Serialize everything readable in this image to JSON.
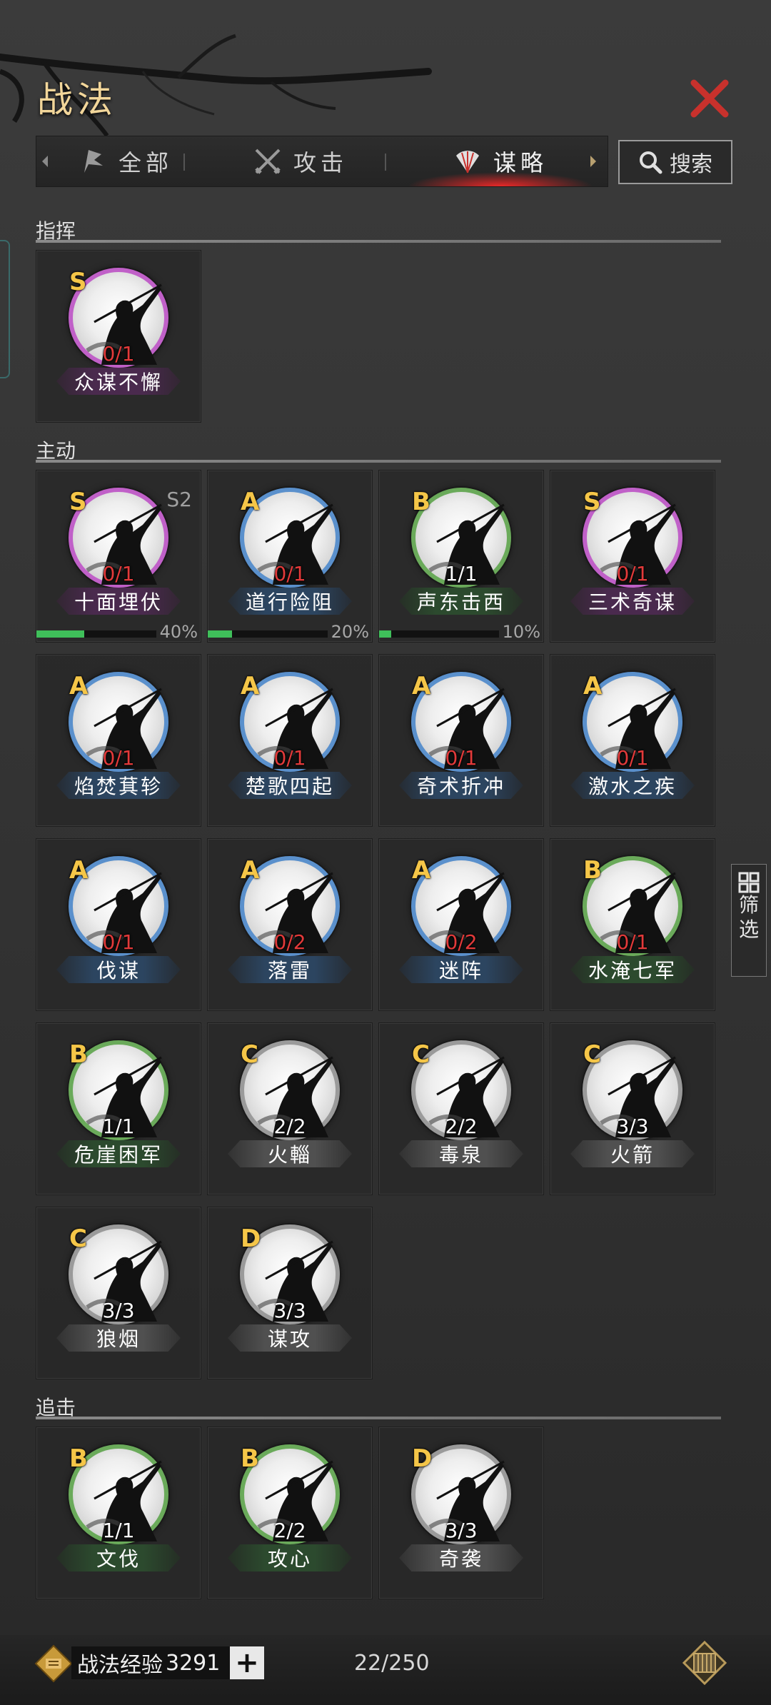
{
  "header": {
    "title": "战法",
    "close_icon": "close-x-icon",
    "accent": "#c8312c"
  },
  "tabs": [
    {
      "label": "全部",
      "icon": "flag-icon",
      "active": false
    },
    {
      "label": "攻击",
      "icon": "crossed-swords-icon",
      "active": false
    },
    {
      "label": "谋略",
      "icon": "fan-icon",
      "active": true
    }
  ],
  "search": {
    "label": "搜索",
    "icon": "search-icon"
  },
  "filter": {
    "label_1": "筛",
    "label_2": "选",
    "icon": "grid-icon"
  },
  "sections": {
    "command": {
      "title": "指挥",
      "cards": [
        {
          "grade": "S",
          "count": "0/1",
          "count_red": true,
          "name": "众谋不懈",
          "tier": "purple"
        }
      ]
    },
    "active": {
      "title": "主动",
      "cards": [
        {
          "grade": "S",
          "season": "S2",
          "count": "0/1",
          "count_red": true,
          "name": "十面埋伏",
          "tier": "purple",
          "progress": 40,
          "progress_label": "40%"
        },
        {
          "grade": "A",
          "count": "0/1",
          "count_red": true,
          "name": "道行险阻",
          "tier": "blue",
          "progress": 20,
          "progress_label": "20%"
        },
        {
          "grade": "B",
          "count": "1/1",
          "count_red": false,
          "name": "声东击西",
          "tier": "green",
          "progress": 10,
          "progress_label": "10%"
        },
        {
          "grade": "S",
          "count": "0/1",
          "count_red": true,
          "name": "三术奇谋",
          "tier": "purple"
        },
        {
          "grade": "A",
          "count": "0/1",
          "count_red": true,
          "name": "焰焚萁轸",
          "tier": "blue"
        },
        {
          "grade": "A",
          "count": "0/1",
          "count_red": true,
          "name": "楚歌四起",
          "tier": "blue"
        },
        {
          "grade": "A",
          "count": "0/1",
          "count_red": true,
          "name": "奇术折冲",
          "tier": "blue"
        },
        {
          "grade": "A",
          "count": "0/1",
          "count_red": true,
          "name": "激水之疾",
          "tier": "blue"
        },
        {
          "grade": "A",
          "count": "0/1",
          "count_red": true,
          "name": "伐谋",
          "tier": "blue"
        },
        {
          "grade": "A",
          "count": "0/2",
          "count_red": true,
          "name": "落雷",
          "tier": "blue"
        },
        {
          "grade": "A",
          "count": "0/2",
          "count_red": true,
          "name": "迷阵",
          "tier": "blue"
        },
        {
          "grade": "B",
          "count": "0/1",
          "count_red": true,
          "name": "水淹七军",
          "tier": "green"
        },
        {
          "grade": "B",
          "count": "1/1",
          "count_red": false,
          "name": "危崖困军",
          "tier": "green"
        },
        {
          "grade": "C",
          "count": "2/2",
          "count_red": false,
          "name": "火輜",
          "tier": "gray"
        },
        {
          "grade": "C",
          "count": "2/2",
          "count_red": false,
          "name": "毒泉",
          "tier": "gray"
        },
        {
          "grade": "C",
          "count": "3/3",
          "count_red": false,
          "name": "火箭",
          "tier": "gray"
        },
        {
          "grade": "C",
          "count": "3/3",
          "count_red": false,
          "name": "狼烟",
          "tier": "gray"
        },
        {
          "grade": "D",
          "count": "3/3",
          "count_red": false,
          "name": "谋攻",
          "tier": "gray"
        }
      ]
    },
    "pursuit": {
      "title": "追击",
      "cards": [
        {
          "grade": "B",
          "count": "1/1",
          "count_red": false,
          "name": "文伐",
          "tier": "green"
        },
        {
          "grade": "B",
          "count": "2/2",
          "count_red": false,
          "name": "攻心",
          "tier": "green"
        },
        {
          "grade": "D",
          "count": "3/3",
          "count_red": false,
          "name": "奇袭",
          "tier": "gray"
        }
      ]
    }
  },
  "tier_colors": {
    "purple": "#c060c8",
    "blue": "#5a90cc",
    "green": "#6aaa5a",
    "gray": "#9a9a9a"
  },
  "bottom": {
    "exp_label": "战法经验",
    "exp_value": "3291",
    "plus": "+",
    "capacity": "22/250"
  }
}
